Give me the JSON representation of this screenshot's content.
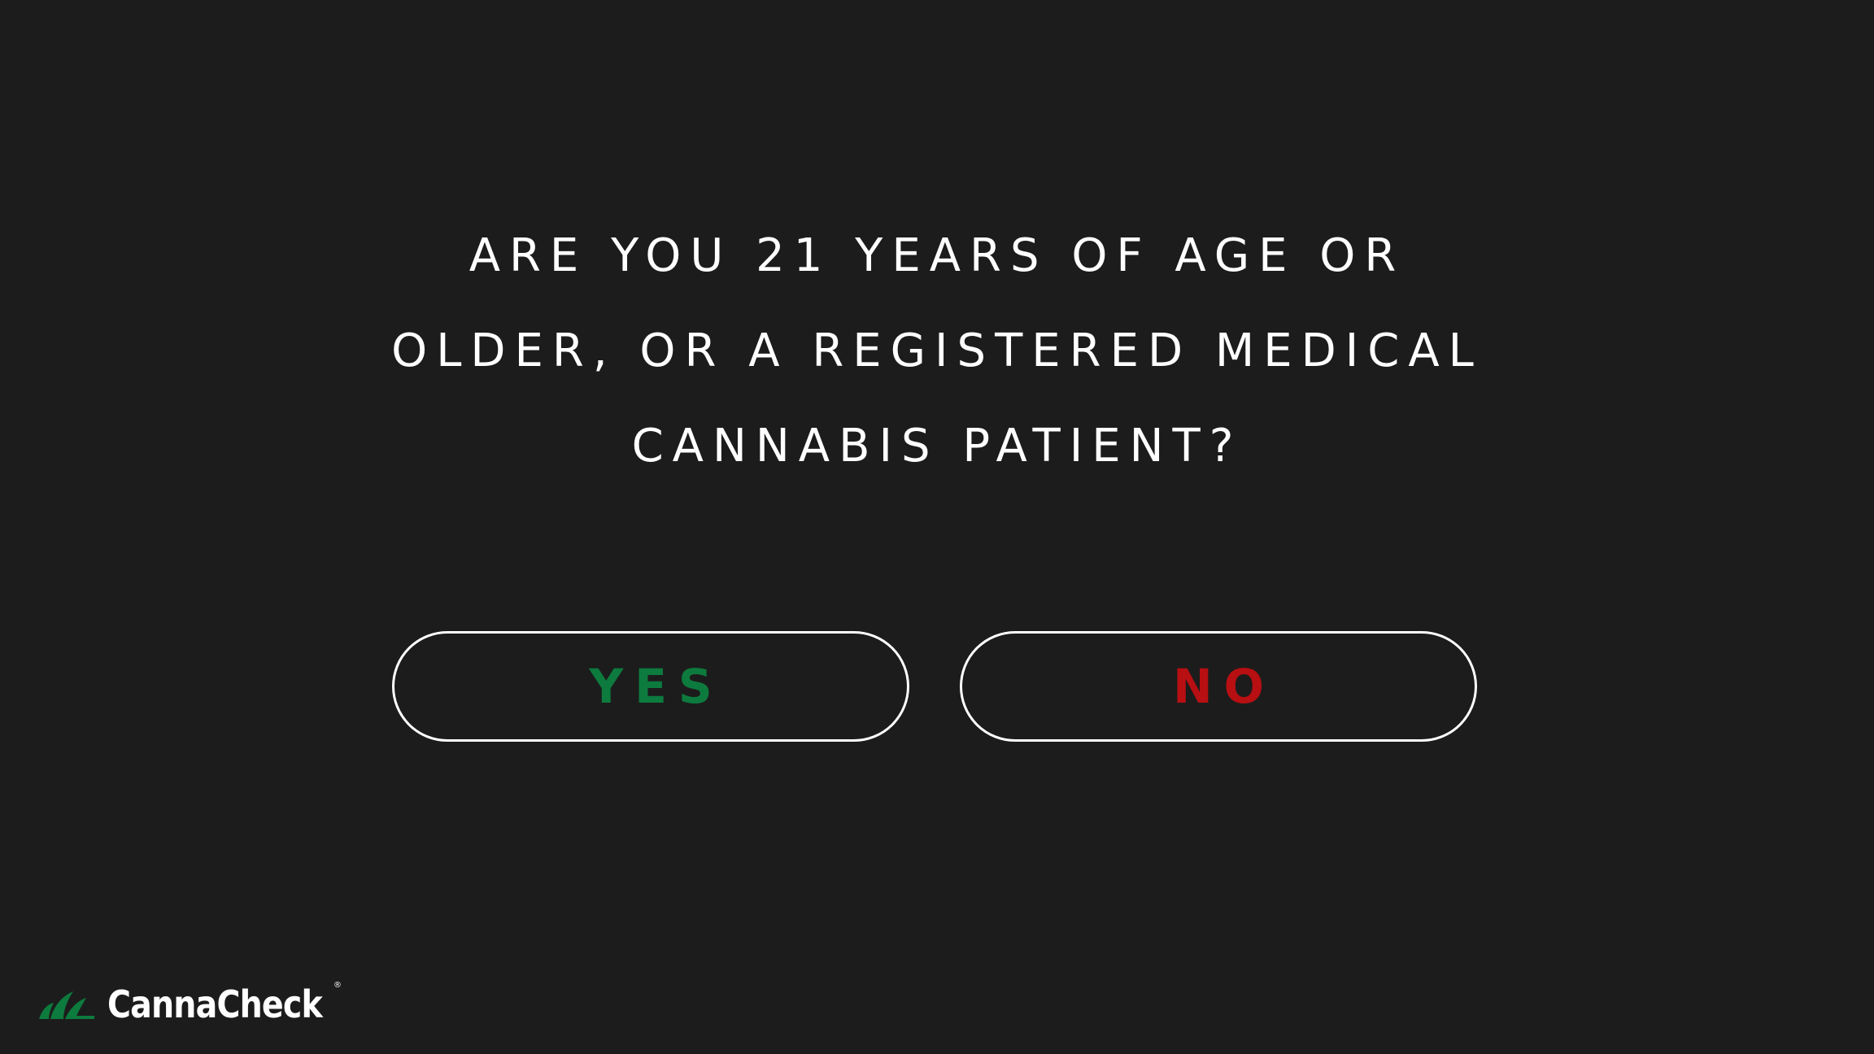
{
  "prompt": {
    "lines": [
      "ARE YOU 21 YEARS OF AGE OR",
      "OLDER, OR A REGISTERED MEDICAL",
      "CANNABIS PATIENT?"
    ]
  },
  "buttons": {
    "yes_label": "YES",
    "no_label": "NO"
  },
  "brand": {
    "name": "CannaCheck",
    "registered_mark": "®"
  },
  "colors": {
    "background": "#1c1c1c",
    "text": "#ffffff",
    "yes": "#0d7a3e",
    "no": "#b70f12",
    "logo_green": "#0d7a3e"
  },
  "icons": {
    "logo": "leaf-logo-icon"
  }
}
